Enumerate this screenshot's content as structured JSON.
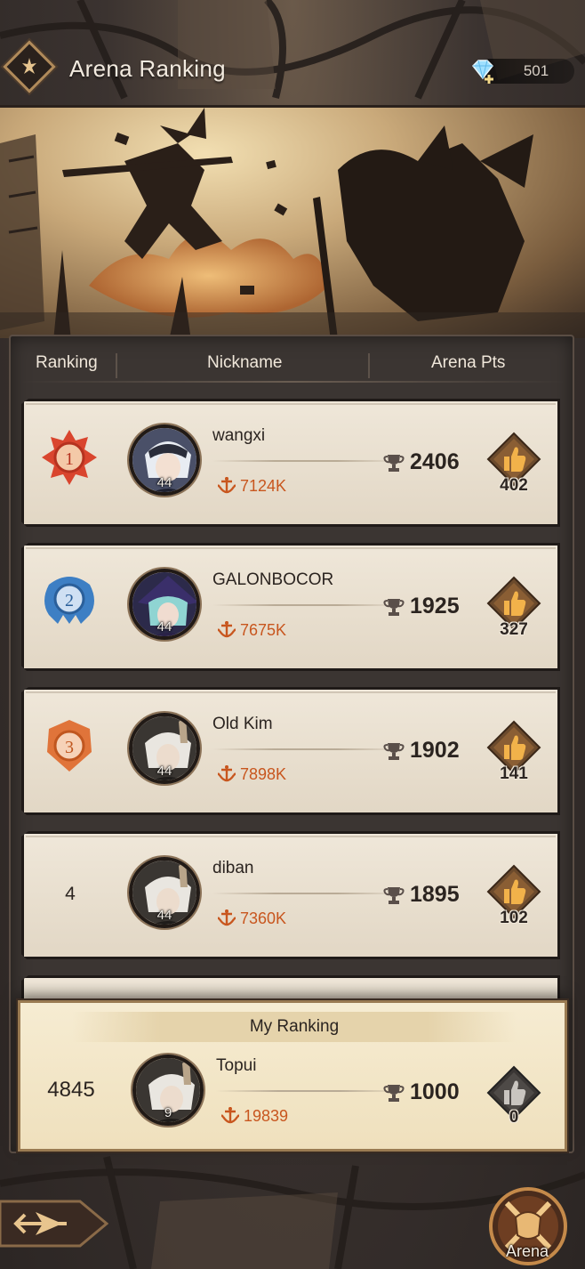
{
  "header": {
    "title": "Arena Ranking",
    "logo_icon": "arena-emblem-icon",
    "currency": {
      "icon": "diamond-plus-icon",
      "amount": "501"
    }
  },
  "table": {
    "columns": {
      "ranking": "Ranking",
      "nickname": "Nickname",
      "arena_pts": "Arena Pts"
    },
    "rows": [
      {
        "rank": "1",
        "rank_style": "gold",
        "nickname": "wangxi",
        "level": "44",
        "power": "7124K",
        "points": "2406",
        "likes": "402"
      },
      {
        "rank": "2",
        "rank_style": "silver",
        "nickname": "GALONBOCOR",
        "level": "44",
        "power": "7675K",
        "points": "1925",
        "likes": "327"
      },
      {
        "rank": "3",
        "rank_style": "bronze",
        "nickname": "Old Kim",
        "level": "44",
        "power": "7898K",
        "points": "1902",
        "likes": "141"
      },
      {
        "rank": "4",
        "rank_style": "plain",
        "nickname": "diban",
        "level": "44",
        "power": "7360K",
        "points": "1895",
        "likes": "102"
      }
    ]
  },
  "my_ranking": {
    "title": "My Ranking",
    "rank": "4845",
    "nickname": "Topui",
    "level": "9",
    "power": "19839",
    "points": "1000",
    "likes": "0"
  },
  "footer": {
    "arena_label": "Arena"
  },
  "colors": {
    "power_text": "#c8561e",
    "rank1": "#d9452e",
    "rank2": "#3d7fc4",
    "rank3": "#e0743a"
  }
}
